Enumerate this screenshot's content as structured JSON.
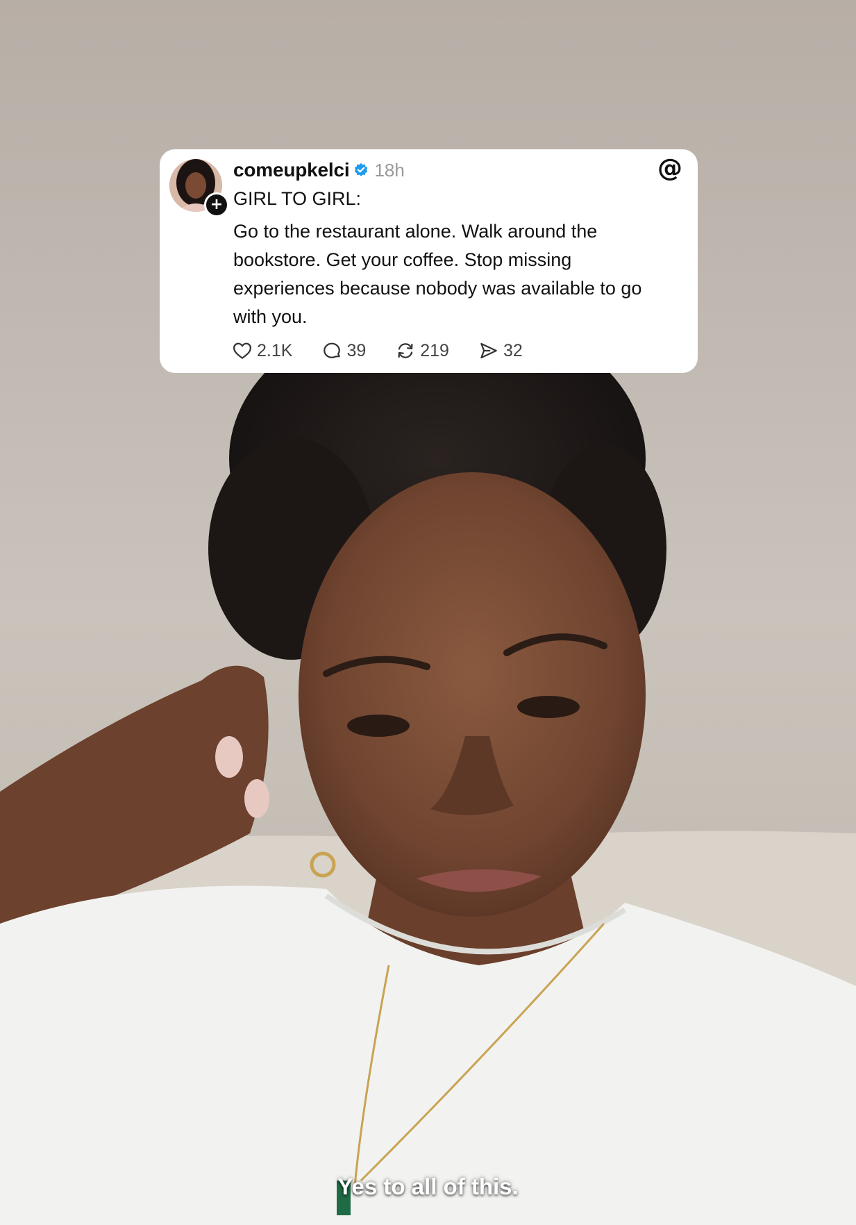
{
  "post": {
    "username": "comeupkelci",
    "timestamp": "18h",
    "heading": "GIRL TO GIRL:",
    "body": "Go to the restaurant alone. Walk around the bookstore. Get your coffee. Stop missing experiences because nobody was available to go with you.",
    "stats": {
      "likes": "2.1K",
      "replies": "39",
      "reposts": "219",
      "shares": "32"
    }
  },
  "caption": "Yes to all of this.",
  "icons": {
    "verified": "verified-badge-icon",
    "app_logo": "threads-logo-icon",
    "like": "heart-icon",
    "reply": "speech-bubble-icon",
    "repost": "repost-arrows-icon",
    "share": "send-icon",
    "follow": "plus-icon"
  },
  "colors": {
    "card_background": "#ffffff",
    "verified_blue": "#1d9bf0",
    "wall": "#bdb6ae",
    "shirt": "#f2f2f0"
  }
}
